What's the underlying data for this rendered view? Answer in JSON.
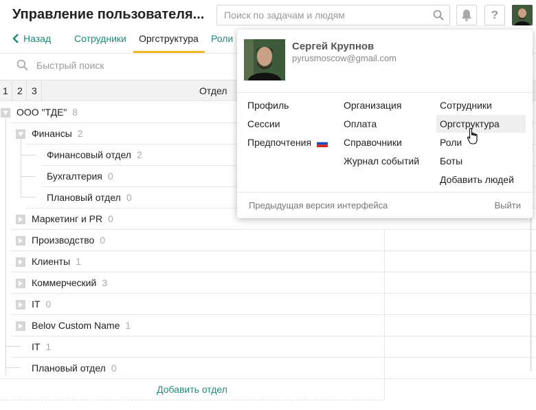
{
  "header": {
    "title": "Управление пользователя...",
    "search_placeholder": "Поиск по задачам и людям",
    "help_label": "?"
  },
  "nav": {
    "back_label": "Назад",
    "tabs": [
      {
        "label": "Сотрудники"
      },
      {
        "label": "Оргструктура"
      },
      {
        "label": "Роли"
      }
    ]
  },
  "quick_search": {
    "placeholder": "Быстрый поиск"
  },
  "table": {
    "levels": [
      "1",
      "2",
      "3"
    ],
    "column": "Отдел",
    "rows": [
      {
        "name": "ООО \"ТДЕ\"",
        "count": "8"
      },
      {
        "name": "Финансы",
        "count": "2"
      },
      {
        "name": "Финансовый отдел",
        "count": "2"
      },
      {
        "name": "Бухгалтерия",
        "count": "0"
      },
      {
        "name": "Плановый отдел",
        "count": "0"
      },
      {
        "name": "Маркетинг и PR",
        "count": "0"
      },
      {
        "name": "Производство",
        "count": "0"
      },
      {
        "name": "Клиенты",
        "count": "1"
      },
      {
        "name": "Коммерческий",
        "count": "3"
      },
      {
        "name": "IT",
        "count": "0"
      },
      {
        "name": "Belov Custom Name",
        "count": "1"
      },
      {
        "name": "IT",
        "count": "1"
      },
      {
        "name": "Плановый отдел",
        "count": "0"
      }
    ],
    "add_label": "Добавить отдел"
  },
  "popup": {
    "user_name": "Сергей Крупнов",
    "email": "pyrusmoscow@gmail.com",
    "col1": [
      "Профиль",
      "Сессии",
      "Предпочтения"
    ],
    "col2": [
      "Организация",
      "Оплата",
      "Справочники",
      "Журнал событий"
    ],
    "col3": [
      "Сотрудники",
      "Оргструктура",
      "Роли",
      "Боты",
      "Добавить людей"
    ],
    "prev_version": "Предыдущая версия интерфейса",
    "logout": "Выйти"
  },
  "colors": {
    "accent": "#1f8a78",
    "tab_underline": "#f2b824"
  }
}
